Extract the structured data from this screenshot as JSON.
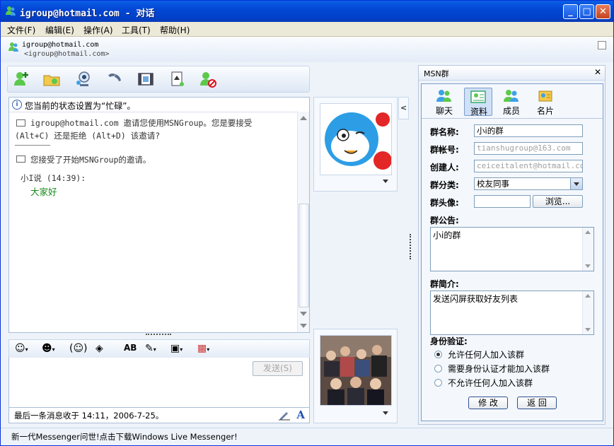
{
  "window": {
    "title": "igroup@hotmail.com - 对话",
    "minimize": "_",
    "maximize": "□",
    "close": "✕"
  },
  "menu": [
    "文件(F)",
    "编辑(E)",
    "操作(A)",
    "工具(T)",
    "帮助(H)"
  ],
  "contact": {
    "name": "igroup@hotmail.com",
    "email": "<igroup@hotmail.com>"
  },
  "toolbar_icons": [
    "invite-icon",
    "send-files-icon",
    "webcam-icon",
    "voice-call-icon",
    "video-icon",
    "activities-icon",
    "block-icon"
  ],
  "chat": {
    "status_line": "您当前的状态设置为“忙碌”。",
    "invite_line1": "igroup@hotmail.com  邀请您使用MSNGroup。您是要接受",
    "invite_line2": "(Alt+C) 还是拒绝 (Alt+D) 该邀请?",
    "accept_line": "您接受了开始MSNGroup的邀请。",
    "speaker": "小I说 (14:39):",
    "message": "大家好"
  },
  "input": {
    "send_label": "发送(S)"
  },
  "last_message": "最后一条消息收于 14:11，2006-7-25。",
  "footer": "新一代Messenger问世!点击下载Windows Live Messenger!",
  "panel": {
    "title": "MSN群",
    "close": "✕",
    "tabs": [
      "聊天",
      "资料",
      "成员",
      "名片"
    ],
    "fields": {
      "name_label": "群名称:",
      "name_value": "小i的群",
      "account_label": "群帐号:",
      "account_value": "tianshugroup@163.com",
      "creator_label": "创建人:",
      "creator_value": "ceiceitalent@hotmail.com",
      "category_label": "群分类:",
      "category_value": "校友同事",
      "avatar_label": "群头像:",
      "browse_label": "浏览...",
      "notice_label": "群公告:",
      "notice_value": "小i的群",
      "intro_label": "群简介:",
      "intro_value": "发送闪屏获取好友列表",
      "auth_label": "身份验证:",
      "auth_options": [
        "允许任何人加入该群",
        "需要身份认证才能加入该群",
        "不允许任何人加入该群"
      ],
      "auth_selected": 0
    },
    "modify_label": "修 改",
    "back_label": "返 回"
  },
  "colors": {
    "title_bar": "#0347d4",
    "message_green": "#1a8a1a",
    "accent_blue": "#2152b2"
  }
}
